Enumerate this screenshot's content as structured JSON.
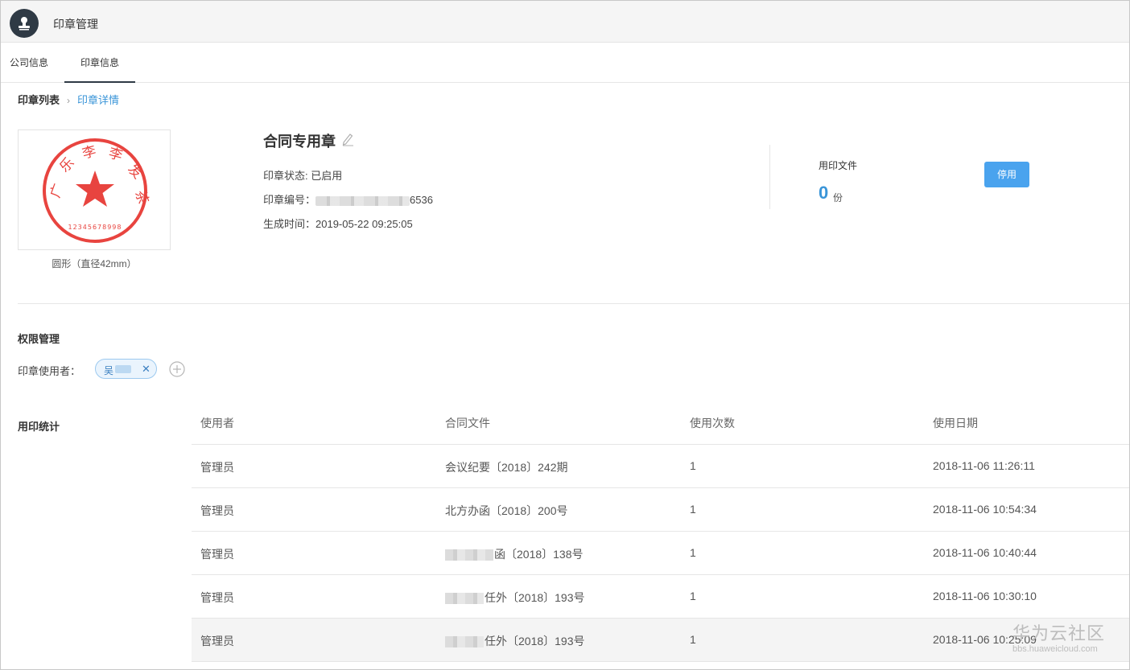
{
  "app": {
    "title": "印章管理",
    "logo_icon": "seal-stamp-icon"
  },
  "tabs": [
    {
      "label": "公司信息"
    },
    {
      "label": "印章信息",
      "active": true
    }
  ],
  "breadcrumb": {
    "root": "印章列表",
    "current": "印章详情"
  },
  "seal": {
    "shape_caption": "圆形（直径42mm）",
    "name": "合同专用章",
    "status_line": "印章状态: 已启用",
    "number_label": "印章编号：",
    "number_suffix": "6536",
    "created_line": "生成时间：2019-05-22 09:25:05",
    "image_chars": [
      "广",
      "乐",
      "李",
      "李",
      "发",
      "茶"
    ],
    "image_digits": "12345678998",
    "seal_color": "#e8443f"
  },
  "documents": {
    "label": "用印文件",
    "count": "0",
    "unit": "份"
  },
  "actions": {
    "disable_label": "停用"
  },
  "permissions": {
    "title": "权限管理",
    "users_label": "印章使用者：",
    "users": [
      {
        "name": "吴"
      }
    ]
  },
  "stats": {
    "title": "用印统计",
    "columns": [
      "使用者",
      "合同文件",
      "使用次数",
      "使用日期"
    ],
    "rows": [
      {
        "user": "管理员",
        "doc_prefix_blurred": false,
        "doc": "会议纪要〔2018〕242期",
        "count": "1",
        "date": "2018-11-06 11:26:11"
      },
      {
        "user": "管理员",
        "doc_prefix_blurred": false,
        "doc": "北方办函〔2018〕200号",
        "count": "1",
        "date": "2018-11-06 10:54:34"
      },
      {
        "user": "管理员",
        "doc_prefix_blurred": true,
        "doc": "函〔2018〕138号",
        "count": "1",
        "date": "2018-11-06 10:40:44"
      },
      {
        "user": "管理员",
        "doc_prefix_blurred": true,
        "doc": "任外〔2018〕193号",
        "count": "1",
        "date": "2018-11-06 10:30:10"
      },
      {
        "user": "管理员",
        "doc_prefix_blurred": true,
        "doc": "任外〔2018〕193号",
        "count": "1",
        "date": "2018-11-06 10:25:09"
      }
    ]
  },
  "watermark": {
    "title": "华为云社区",
    "url": "bbs.huaweicloud.com"
  },
  "colors": {
    "accent": "#3a95d8",
    "button": "#4aa3ee",
    "header_bg": "#f5f5f5",
    "dark": "#2f3a45"
  }
}
